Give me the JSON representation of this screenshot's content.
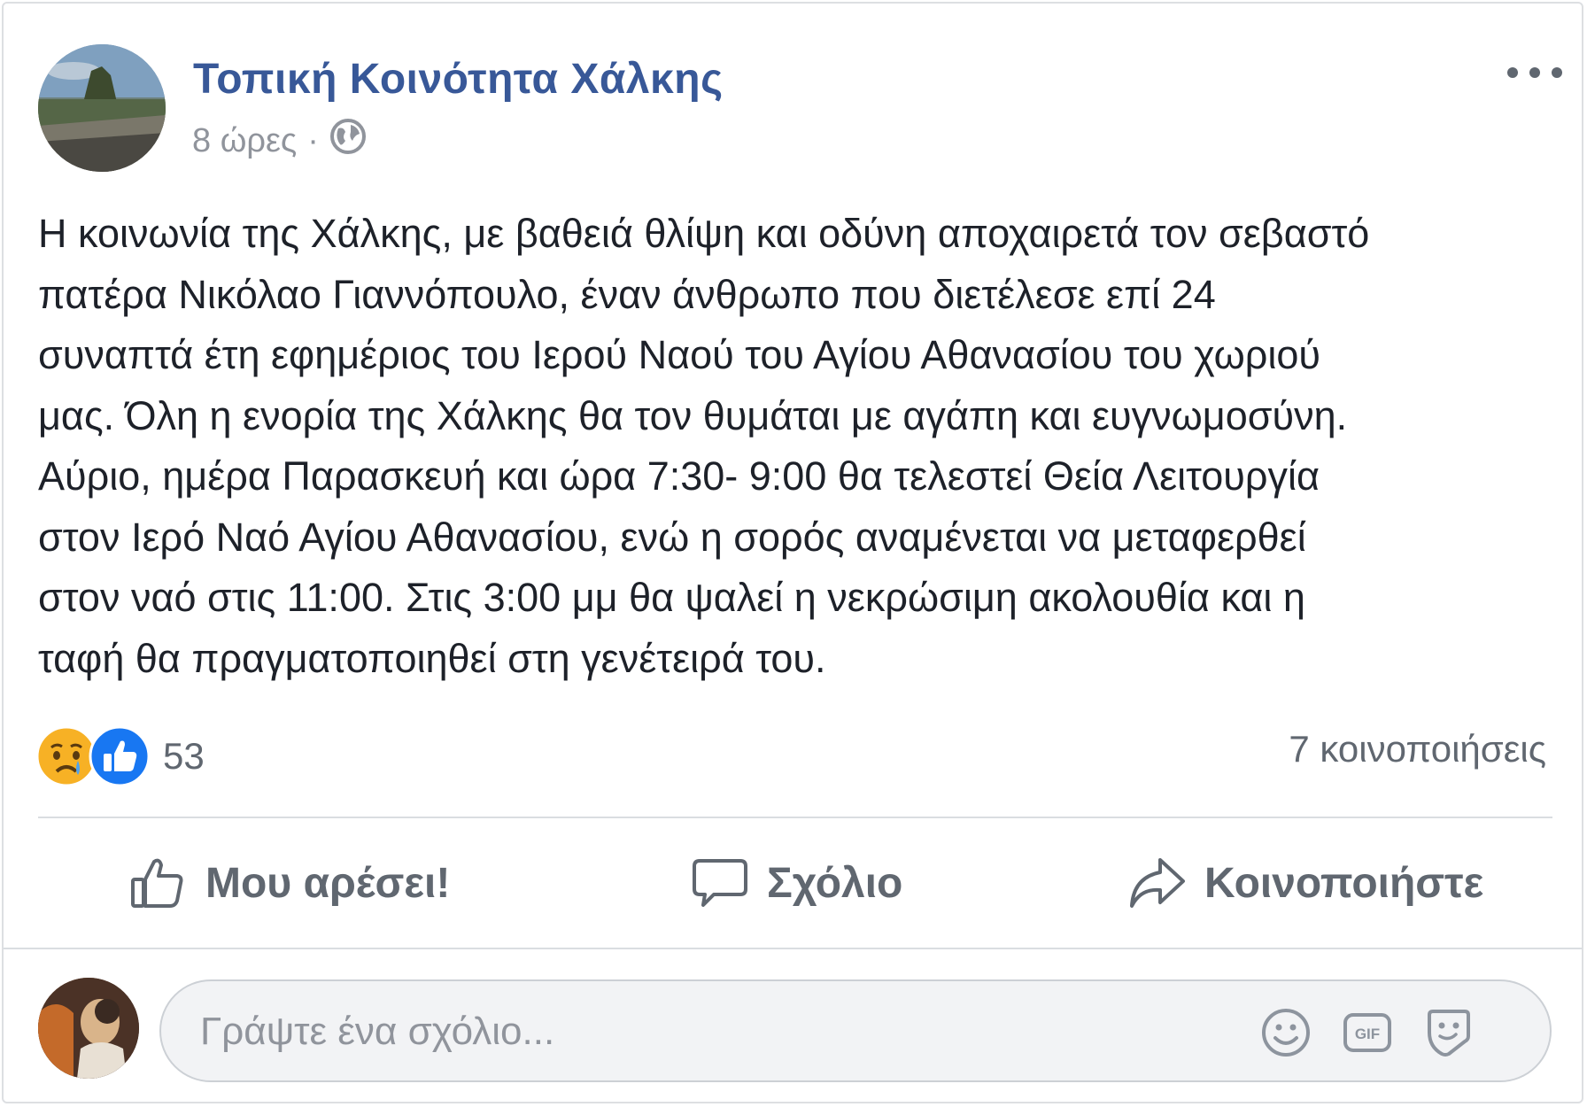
{
  "post": {
    "page_name": "Τοπική Κοινότητα Χάλκης",
    "time": "8 ώρες",
    "separator": "·",
    "privacy_icon": "globe-icon",
    "more_icon": "more-dots-icon",
    "lines": [
      "Η κοινωνία της Χάλκης, με βαθειά θλίψη και οδύνη αποχαιρετά τον σεβαστό",
      "πατέρα Νικόλαο Γιαννόπουλο, έναν άνθρωπο που διετέλεσε επί 24",
      "συναπτά έτη εφημέριος του Ιερού Ναού του Αγίου Αθανασίου του χωριού",
      "μας. Όλη η ενορία της Χάλκης θα τον θυμάται με αγάπη και ευγνωμοσύνη.",
      "Αύριο, ημέρα Παρασκευή και ώρα 7:30- 9:00 θα τελεστεί Θεία Λειτουργία",
      "στον Ιερό Ναό Αγίου Αθανασίου, ενώ η σορός αναμένεται να μεταφερθεί",
      "στον ναό στις 11:00. Στις 3:00 μμ θα ψαλεί η νεκρώσιμη ακολουθία και η",
      "ταφή θα πραγματοποιηθεί στη γενέτειρά του."
    ]
  },
  "reactions": {
    "icons": [
      "sad-reaction-icon",
      "like-reaction-icon"
    ],
    "count": "53",
    "shares": "7 κοινοποιήσεις"
  },
  "actions": {
    "like_label": "Μου αρέσει!",
    "comment_label": "Σχόλιο",
    "share_label": "Κοινοποιήστε"
  },
  "comment_input": {
    "placeholder": "Γράψτε ένα σχόλιο...",
    "icons": [
      "emoji-icon",
      "gif-icon",
      "sticker-icon"
    ]
  },
  "colors": {
    "page_name": "#385898",
    "text": "#1d2129",
    "secondary": "#606770",
    "like_blue": "#1877f2",
    "sad_yellow": "#f7b125"
  }
}
